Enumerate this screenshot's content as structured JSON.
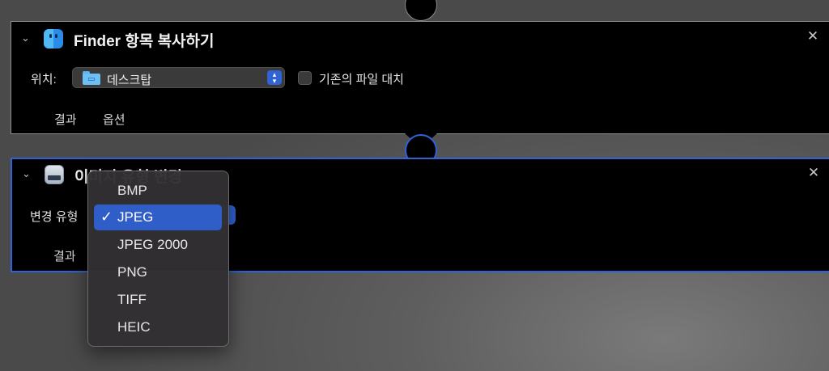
{
  "action1": {
    "title": "Finder 항목 복사하기",
    "location_label": "위치:",
    "location_value": "데스크탑",
    "replace_label": "기존의 파일 대치",
    "tabs": [
      {
        "label": "결과"
      },
      {
        "label": "옵션"
      }
    ]
  },
  "action2": {
    "title": "이미지 유형 변경",
    "type_label": "변경 유형",
    "tabs": [
      {
        "label": "결과"
      }
    ]
  },
  "menu": {
    "items": [
      {
        "label": "BMP",
        "selected": false
      },
      {
        "label": "JPEG",
        "selected": true
      },
      {
        "label": "JPEG 2000",
        "selected": false
      },
      {
        "label": "PNG",
        "selected": false
      },
      {
        "label": "TIFF",
        "selected": false
      },
      {
        "label": "HEIC",
        "selected": false
      }
    ],
    "check_glyph": "✓"
  },
  "icons": {
    "chevron": "⌄",
    "close": "✕",
    "stepper": "▴▾"
  },
  "colors": {
    "accent": "#2f63d6",
    "selected_item": "#2f5ec9",
    "panel_bg": "#000000"
  }
}
